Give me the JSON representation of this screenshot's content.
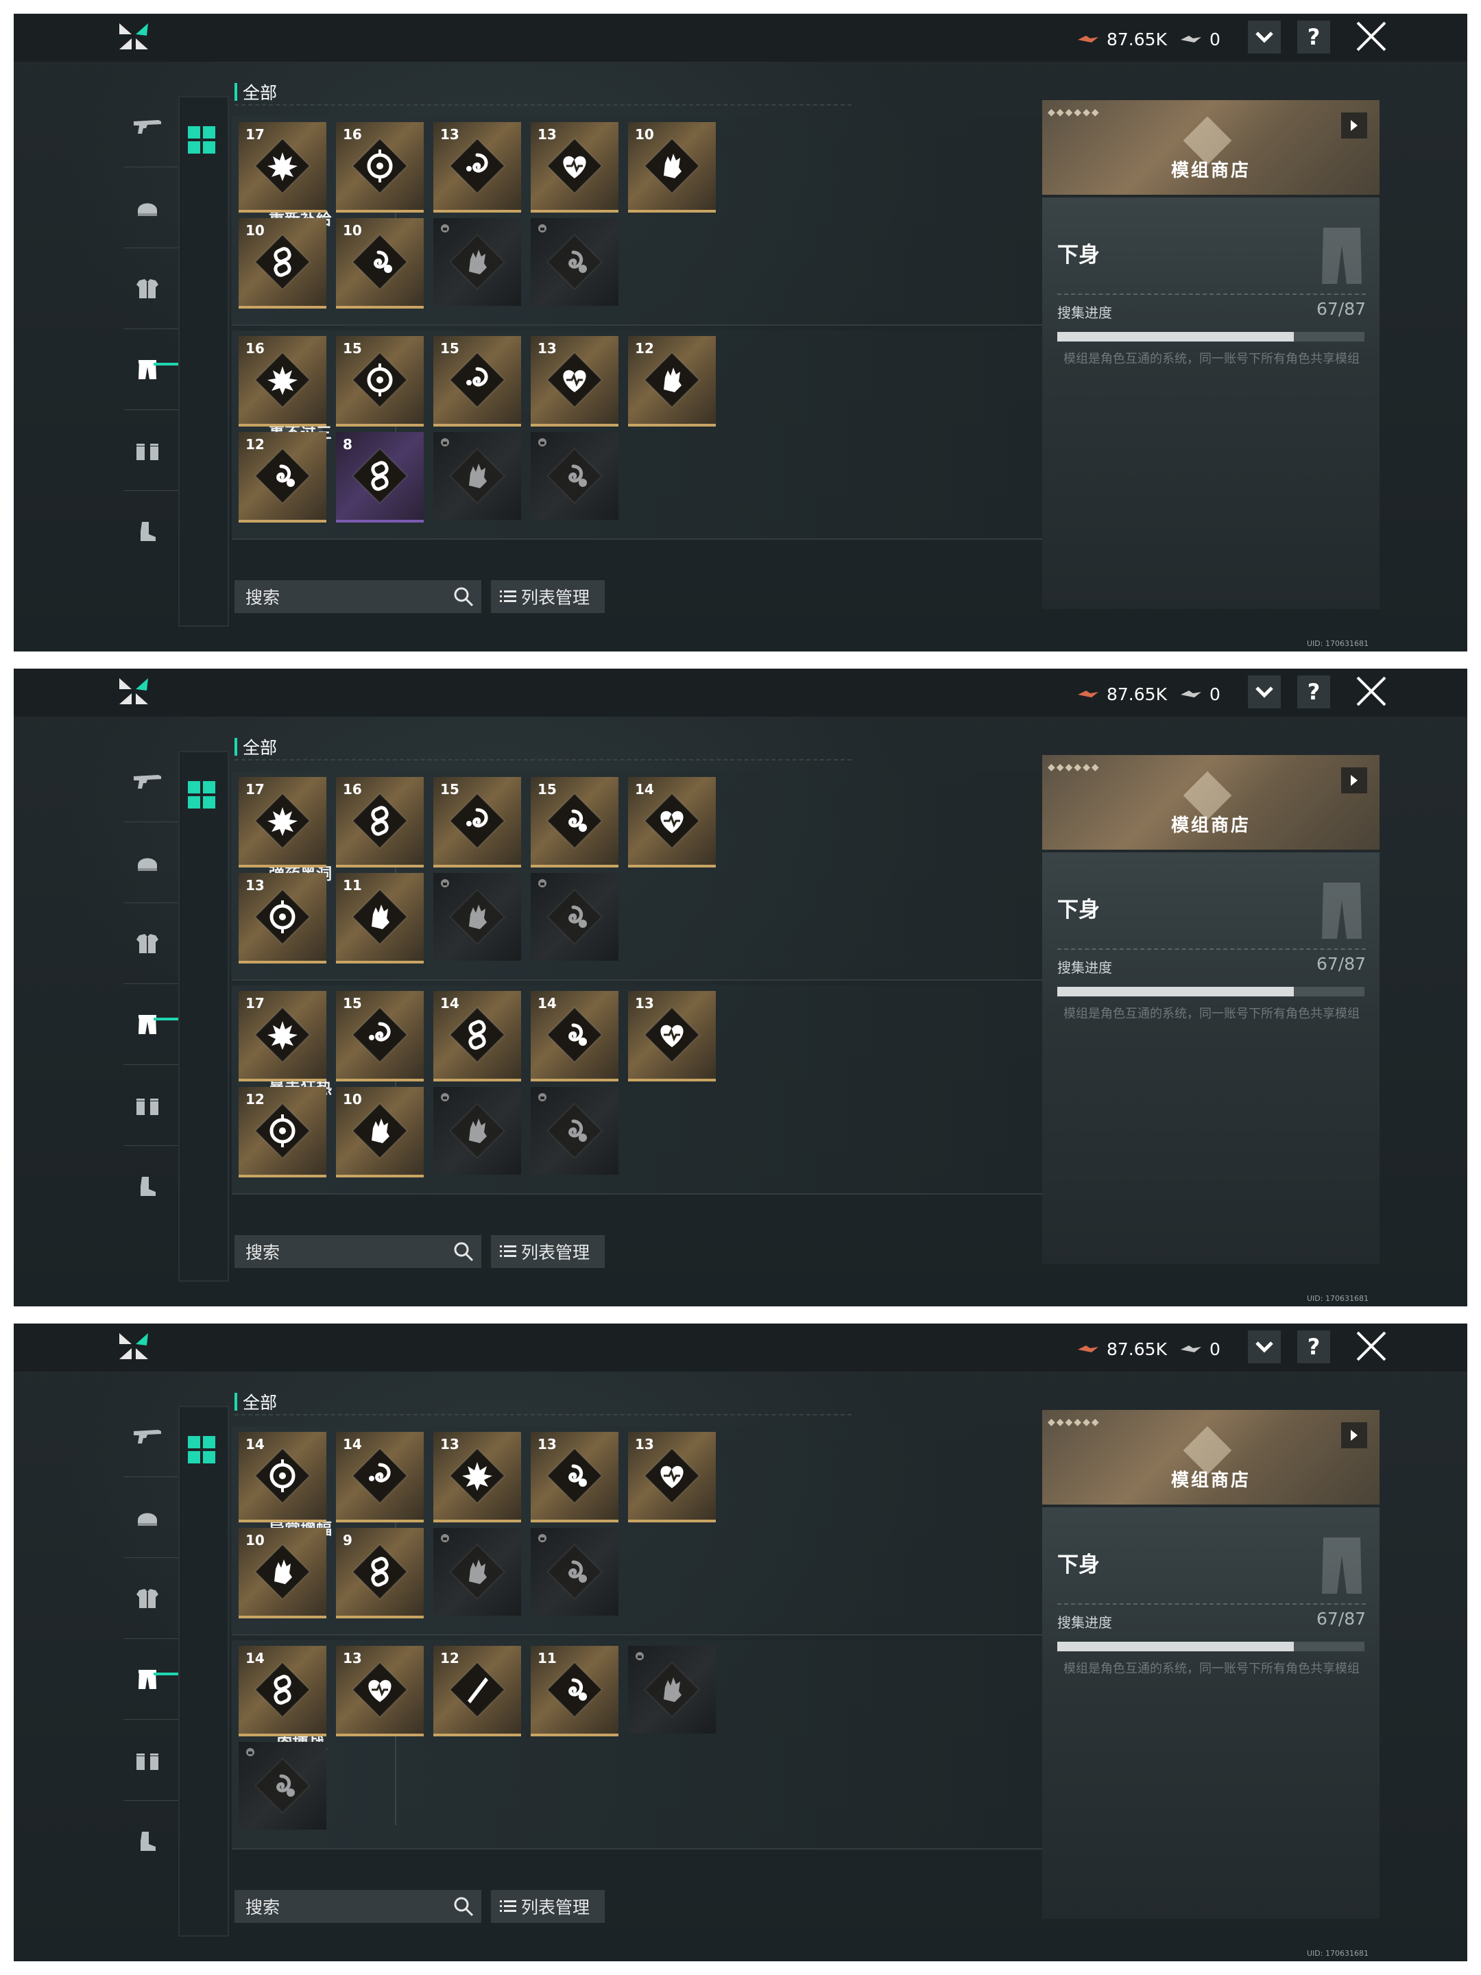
{
  "header": {
    "currency1": "87.65K",
    "currency2": "0",
    "help_label": "?"
  },
  "nav": {
    "items": [
      "weapon-icon",
      "helmet-icon",
      "chest-armor-icon",
      "leg-armor-icon",
      "gloves-icon",
      "boots-icon"
    ],
    "active_index": 3
  },
  "section_title": "全部",
  "search": {
    "placeholder": "搜索"
  },
  "list_manage_label": "列表管理",
  "shop": {
    "label": "模组商店",
    "dots": "◆◆◆◆◆◆"
  },
  "panel": {
    "title": "下身",
    "progress_label": "搜集进度",
    "progress_value": "67/87",
    "progress_fraction": 0.77,
    "description": "模组是角色互通的系统，同一账号下所有角色共享模组"
  },
  "uid": "UID: 170631681",
  "accent": "#1fd7b0",
  "screens": [
    {
      "groups": [
        {
          "label": "重新补给",
          "cards": [
            {
              "n": "17",
              "icon": "explosion",
              "style": "gold"
            },
            {
              "n": "16",
              "icon": "crosshair",
              "style": "gold"
            },
            {
              "n": "13",
              "icon": "spiral",
              "style": "gold"
            },
            {
              "n": "13",
              "icon": "heart",
              "style": "gold"
            },
            {
              "n": "10",
              "icon": "hand",
              "style": "gold"
            },
            {
              "n": "10",
              "icon": "chain",
              "style": "gold"
            },
            {
              "n": "10",
              "icon": "spiral-drop",
              "style": "gold"
            },
            {
              "n": "",
              "icon": "hand",
              "style": "dark"
            },
            {
              "n": "",
              "icon": "spiral-drop",
              "style": "dark"
            }
          ]
        },
        {
          "label": "事不过三",
          "cards": [
            {
              "n": "16",
              "icon": "explosion",
              "style": "gold"
            },
            {
              "n": "15",
              "icon": "crosshair",
              "style": "gold"
            },
            {
              "n": "15",
              "icon": "spiral",
              "style": "gold"
            },
            {
              "n": "13",
              "icon": "heart",
              "style": "gold"
            },
            {
              "n": "12",
              "icon": "hand",
              "style": "gold"
            },
            {
              "n": "12",
              "icon": "spiral-drop",
              "style": "gold"
            },
            {
              "n": "8",
              "icon": "chain",
              "style": "purple"
            },
            {
              "n": "",
              "icon": "hand",
              "style": "dark"
            },
            {
              "n": "",
              "icon": "spiral-drop",
              "style": "dark"
            }
          ]
        }
      ]
    },
    {
      "groups": [
        {
          "label": "弹药黑洞",
          "cards": [
            {
              "n": "17",
              "icon": "explosion",
              "style": "gold"
            },
            {
              "n": "16",
              "icon": "chain",
              "style": "gold"
            },
            {
              "n": "15",
              "icon": "spiral",
              "style": "gold"
            },
            {
              "n": "15",
              "icon": "spiral-drop",
              "style": "gold"
            },
            {
              "n": "14",
              "icon": "heart",
              "style": "gold"
            },
            {
              "n": "13",
              "icon": "crosshair",
              "style": "gold"
            },
            {
              "n": "11",
              "icon": "hand",
              "style": "gold"
            },
            {
              "n": "",
              "icon": "hand",
              "style": "dark"
            },
            {
              "n": "",
              "icon": "spiral-drop",
              "style": "dark"
            }
          ]
        },
        {
          "label": "暴击狂热",
          "cards": [
            {
              "n": "17",
              "icon": "explosion",
              "style": "gold"
            },
            {
              "n": "15",
              "icon": "spiral",
              "style": "gold"
            },
            {
              "n": "14",
              "icon": "chain",
              "style": "gold"
            },
            {
              "n": "14",
              "icon": "spiral-drop",
              "style": "gold"
            },
            {
              "n": "13",
              "icon": "heart",
              "style": "gold"
            },
            {
              "n": "12",
              "icon": "crosshair",
              "style": "gold"
            },
            {
              "n": "10",
              "icon": "hand",
              "style": "gold"
            },
            {
              "n": "",
              "icon": "hand",
              "style": "dark"
            },
            {
              "n": "",
              "icon": "spiral-drop",
              "style": "dark"
            }
          ]
        }
      ]
    },
    {
      "groups": [
        {
          "label": "异常增幅",
          "cards": [
            {
              "n": "14",
              "icon": "crosshair",
              "style": "gold"
            },
            {
              "n": "14",
              "icon": "spiral",
              "style": "gold"
            },
            {
              "n": "13",
              "icon": "explosion",
              "style": "gold"
            },
            {
              "n": "13",
              "icon": "spiral-drop",
              "style": "gold"
            },
            {
              "n": "13",
              "icon": "heart",
              "style": "gold"
            },
            {
              "n": "10",
              "icon": "hand",
              "style": "gold"
            },
            {
              "n": "9",
              "icon": "chain",
              "style": "gold"
            },
            {
              "n": "",
              "icon": "hand",
              "style": "dark"
            },
            {
              "n": "",
              "icon": "spiral-drop",
              "style": "dark"
            }
          ]
        },
        {
          "label": "肉搏战",
          "cards": [
            {
              "n": "14",
              "icon": "chain",
              "style": "gold"
            },
            {
              "n": "13",
              "icon": "heart",
              "style": "gold"
            },
            {
              "n": "12",
              "icon": "blade",
              "style": "gold"
            },
            {
              "n": "11",
              "icon": "spiral-drop",
              "style": "gold"
            },
            {
              "n": "",
              "icon": "hand",
              "style": "dark"
            },
            {
              "n": "",
              "icon": "spiral-drop",
              "style": "dark"
            }
          ]
        }
      ]
    }
  ]
}
